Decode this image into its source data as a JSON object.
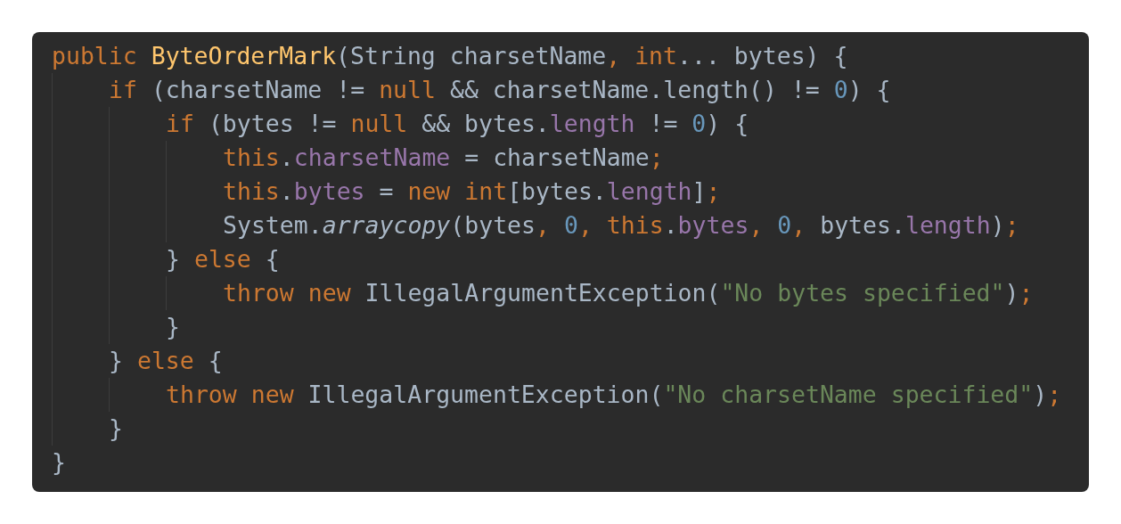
{
  "code": {
    "lines": [
      {
        "tokens": [
          {
            "text": "public ",
            "kind": "keyword"
          },
          {
            "text": "ByteOrderMark",
            "kind": "declaration"
          },
          {
            "text": "(String charsetName",
            "kind": "plain"
          },
          {
            "text": ", int",
            "kind": "keyword"
          },
          {
            "text": "... bytes) {",
            "kind": "plain"
          }
        ],
        "children": [
          {
            "tokens": [
              {
                "text": "if ",
                "kind": "keyword"
              },
              {
                "text": "(charsetName != ",
                "kind": "plain"
              },
              {
                "text": "null ",
                "kind": "keyword"
              },
              {
                "text": "&& charsetName.length() != ",
                "kind": "plain"
              },
              {
                "text": "0",
                "kind": "number"
              },
              {
                "text": ") {",
                "kind": "plain"
              }
            ],
            "children": [
              {
                "tokens": [
                  {
                    "text": "if ",
                    "kind": "keyword"
                  },
                  {
                    "text": "(bytes != ",
                    "kind": "plain"
                  },
                  {
                    "text": "null ",
                    "kind": "keyword"
                  },
                  {
                    "text": "&& bytes.",
                    "kind": "plain"
                  },
                  {
                    "text": "length",
                    "kind": "field"
                  },
                  {
                    "text": " != ",
                    "kind": "plain"
                  },
                  {
                    "text": "0",
                    "kind": "number"
                  },
                  {
                    "text": ") {",
                    "kind": "plain"
                  }
                ],
                "children": [
                  {
                    "tokens": [
                      {
                        "text": "this",
                        "kind": "keyword"
                      },
                      {
                        "text": ".",
                        "kind": "plain"
                      },
                      {
                        "text": "charsetName",
                        "kind": "field"
                      },
                      {
                        "text": " = charsetName",
                        "kind": "plain"
                      },
                      {
                        "text": ";",
                        "kind": "keyword"
                      }
                    ]
                  },
                  {
                    "tokens": [
                      {
                        "text": "this",
                        "kind": "keyword"
                      },
                      {
                        "text": ".",
                        "kind": "plain"
                      },
                      {
                        "text": "bytes",
                        "kind": "field"
                      },
                      {
                        "text": " = ",
                        "kind": "plain"
                      },
                      {
                        "text": "new int",
                        "kind": "keyword"
                      },
                      {
                        "text": "[bytes.",
                        "kind": "plain"
                      },
                      {
                        "text": "length",
                        "kind": "field"
                      },
                      {
                        "text": "]",
                        "kind": "plain"
                      },
                      {
                        "text": ";",
                        "kind": "keyword"
                      }
                    ]
                  },
                  {
                    "tokens": [
                      {
                        "text": "System.",
                        "kind": "plain"
                      },
                      {
                        "text": "arraycopy",
                        "kind": "static-method"
                      },
                      {
                        "text": "(bytes",
                        "kind": "plain"
                      },
                      {
                        "text": ", ",
                        "kind": "keyword"
                      },
                      {
                        "text": "0",
                        "kind": "number"
                      },
                      {
                        "text": ", this",
                        "kind": "keyword"
                      },
                      {
                        "text": ".",
                        "kind": "plain"
                      },
                      {
                        "text": "bytes",
                        "kind": "field"
                      },
                      {
                        "text": ", ",
                        "kind": "keyword"
                      },
                      {
                        "text": "0",
                        "kind": "number"
                      },
                      {
                        "text": ", ",
                        "kind": "keyword"
                      },
                      {
                        "text": "bytes.",
                        "kind": "plain"
                      },
                      {
                        "text": "length",
                        "kind": "field"
                      },
                      {
                        "text": ")",
                        "kind": "plain"
                      },
                      {
                        "text": ";",
                        "kind": "keyword"
                      }
                    ]
                  }
                ]
              },
              {
                "tokens": [
                  {
                    "text": "} ",
                    "kind": "plain"
                  },
                  {
                    "text": "else ",
                    "kind": "keyword"
                  },
                  {
                    "text": "{",
                    "kind": "plain"
                  }
                ],
                "children": [
                  {
                    "tokens": [
                      {
                        "text": "throw new ",
                        "kind": "keyword"
                      },
                      {
                        "text": "IllegalArgumentException(",
                        "kind": "plain"
                      },
                      {
                        "text": "\"No bytes specified\"",
                        "kind": "string"
                      },
                      {
                        "text": ")",
                        "kind": "plain"
                      },
                      {
                        "text": ";",
                        "kind": "keyword"
                      }
                    ]
                  }
                ]
              },
              {
                "tokens": [
                  {
                    "text": "}",
                    "kind": "plain"
                  }
                ]
              }
            ]
          },
          {
            "tokens": [
              {
                "text": "} ",
                "kind": "plain"
              },
              {
                "text": "else ",
                "kind": "keyword"
              },
              {
                "text": "{",
                "kind": "plain"
              }
            ],
            "children": [
              {
                "tokens": [
                  {
                    "text": "throw new ",
                    "kind": "keyword"
                  },
                  {
                    "text": "IllegalArgumentException(",
                    "kind": "plain"
                  },
                  {
                    "text": "\"No charsetName specified\"",
                    "kind": "string"
                  },
                  {
                    "text": ")",
                    "kind": "plain"
                  },
                  {
                    "text": ";",
                    "kind": "keyword"
                  }
                ]
              }
            ]
          },
          {
            "tokens": [
              {
                "text": "}",
                "kind": "plain"
              }
            ]
          }
        ]
      },
      {
        "tokens": [
          {
            "text": "}",
            "kind": "plain"
          }
        ]
      }
    ]
  }
}
